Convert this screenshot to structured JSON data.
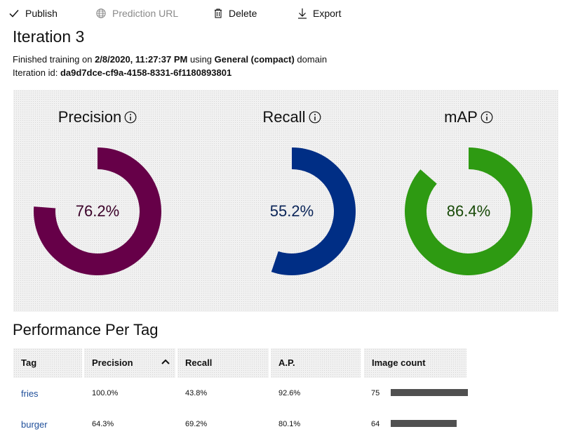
{
  "toolbar": {
    "publish": "Publish",
    "prediction_url": "Prediction URL",
    "delete": "Delete",
    "export": "Export"
  },
  "iteration": {
    "title": "Iteration 3",
    "finished_prefix": "Finished training on ",
    "finished_date": "2/8/2020, 11:27:37 PM",
    "finished_mid": " using ",
    "domain_name": "General (compact)",
    "finished_suffix": " domain",
    "id_label": "Iteration id: ",
    "id_value": "da9d7dce-cf9a-4158-8331-6f1180893801"
  },
  "metrics": [
    {
      "name": "Precision",
      "value": 0.762,
      "label": "76.2%",
      "color": "#660048",
      "text_color": "#3a0028"
    },
    {
      "name": "Recall",
      "value": 0.552,
      "label": "55.2%",
      "color": "#002e85",
      "text_color": "#0a2458"
    },
    {
      "name": "mAP",
      "value": 0.864,
      "label": "86.4%",
      "color": "#2e9a12",
      "text_color": "#184a08"
    }
  ],
  "performance": {
    "title": "Performance Per Tag",
    "columns": [
      "Tag",
      "Precision",
      "Recall",
      "A.P.",
      "Image count"
    ],
    "rows": [
      {
        "tag": "fries",
        "precision": "100.0%",
        "recall": "43.8%",
        "ap": "92.6%",
        "image_count": "75",
        "count_value": 75
      },
      {
        "tag": "burger",
        "precision": "64.3%",
        "recall": "69.2%",
        "ap": "80.1%",
        "image_count": "64",
        "count_value": 64
      }
    ],
    "max_count": 75
  },
  "colors": {
    "bar": "#505050",
    "link": "#1f4f9a"
  }
}
